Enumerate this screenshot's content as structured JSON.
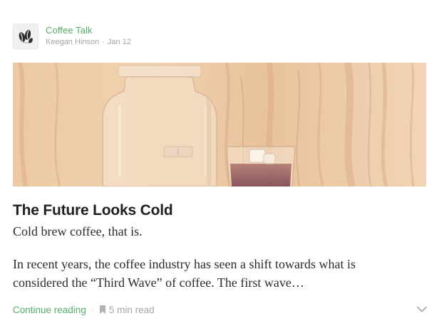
{
  "post": {
    "publication_name": "Coffee Talk",
    "author": "Keegan Hinson",
    "separator": "·",
    "date": "Jan 12",
    "title": "The Future Looks Cold",
    "subtitle": "Cold brew coffee, that is.",
    "excerpt": "In recent years, the coffee industry has seen a shift towards what is considered the “Third Wave” of coffee. The first wave…",
    "continue_label": "Continue reading",
    "footer_separator": "·",
    "read_time": "5 min read"
  },
  "icons": {
    "avatar": "coffee-beans-logo",
    "bookmark": "bookmark-icon",
    "chevron": "chevron-down-icon"
  },
  "colors": {
    "accent": "#57ad68",
    "muted": "#a6a6a6",
    "text": "#2b2b2b"
  }
}
